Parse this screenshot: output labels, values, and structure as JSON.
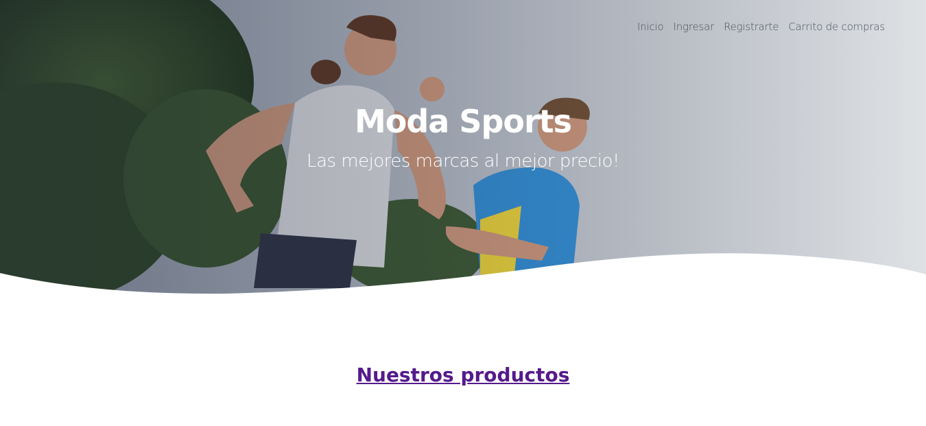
{
  "nav": {
    "items": [
      {
        "label": "Inicio"
      },
      {
        "label": "Ingresar"
      },
      {
        "label": "Registrarte"
      },
      {
        "label": "Carrito de compras"
      }
    ]
  },
  "hero": {
    "title": "Moda Sports",
    "subtitle": "Las mejores marcas al mejor precio!"
  },
  "products": {
    "heading": "Nuestros productos"
  },
  "colors": {
    "link_visited": "#551a8b",
    "nav_text": "#4a4f5a",
    "hero_text": "#ffffff"
  }
}
